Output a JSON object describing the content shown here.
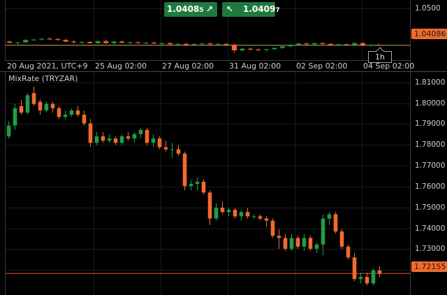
{
  "top_panel": {
    "bid_price": "1.0408",
    "bid_price_fraction": "5",
    "ask_price": "1.0409",
    "ask_price_fraction": "7",
    "current_price_tag": "1.04086",
    "timeframe": "1h",
    "y_ticks": [
      "1.0500"
    ],
    "dates": [
      "20 Aug 2021, UTC+9",
      "25 Aug 02:00",
      "27 Aug 02:00",
      "31 Aug 02:00",
      "02 Sep 02:00",
      "04 Sep 02:00"
    ]
  },
  "indicator_panel": {
    "name": "MixRate (TRYZAR)",
    "current_value_tag": "1.72155",
    "y_ticks": [
      "1.81000",
      "1.80000",
      "1.79000",
      "1.78000",
      "1.77000",
      "1.76000",
      "1.75000",
      "1.74000",
      "1.73000",
      "1.72000"
    ]
  },
  "colors": {
    "bull": "#1f9d48",
    "bear": "#f26a2e",
    "price_line_top": "#c9a94a",
    "price_line_bottom": "#e8543a",
    "tag_top": "#f26a2e",
    "tag_bottom": "#f26a2e",
    "button_green": "#1e7a3c"
  },
  "chart_data": [
    {
      "type": "candlestick",
      "title": "",
      "ylim": [
        1.0375,
        1.0515
      ],
      "last_value": 1.04086,
      "candles": [
        [
          1.0418,
          1.042,
          1.0413,
          1.0415
        ],
        [
          1.0415,
          1.0418,
          1.0411,
          1.0416
        ],
        [
          1.0416,
          1.0424,
          1.0414,
          1.0422
        ],
        [
          1.0422,
          1.0425,
          1.0419,
          1.0423
        ],
        [
          1.0423,
          1.0426,
          1.042,
          1.0425
        ],
        [
          1.0425,
          1.0428,
          1.0421,
          1.0424
        ],
        [
          1.0424,
          1.0427,
          1.042,
          1.0422
        ],
        [
          1.0422,
          1.0425,
          1.0416,
          1.0418
        ],
        [
          1.0418,
          1.0421,
          1.0413,
          1.0416
        ],
        [
          1.0416,
          1.0419,
          1.0412,
          1.0417
        ],
        [
          1.0417,
          1.0419,
          1.0413,
          1.0414
        ],
        [
          1.0414,
          1.0421,
          1.0412,
          1.0419
        ],
        [
          1.0419,
          1.0423,
          1.0412,
          1.0414
        ],
        [
          1.0414,
          1.042,
          1.041,
          1.0418
        ],
        [
          1.0418,
          1.042,
          1.0413,
          1.0415
        ],
        [
          1.0415,
          1.0418,
          1.0412,
          1.0416
        ],
        [
          1.0416,
          1.0418,
          1.0413,
          1.0414
        ],
        [
          1.0414,
          1.0417,
          1.0411,
          1.0415
        ],
        [
          1.0415,
          1.0418,
          1.0412,
          1.0413
        ],
        [
          1.0413,
          1.0416,
          1.041,
          1.0414
        ],
        [
          1.0414,
          1.0416,
          1.041,
          1.0411
        ],
        [
          1.0411,
          1.0414,
          1.0408,
          1.0412
        ],
        [
          1.0412,
          1.0415,
          1.0409,
          1.041
        ],
        [
          1.041,
          1.0413,
          1.0407,
          1.0412
        ],
        [
          1.0412,
          1.0415,
          1.041,
          1.0413
        ],
        [
          1.0413,
          1.0416,
          1.041,
          1.0411
        ],
        [
          1.0411,
          1.0414,
          1.0408,
          1.0412
        ],
        [
          1.0412,
          1.0414,
          1.0409,
          1.041
        ],
        [
          1.041,
          1.0413,
          1.039,
          1.0396
        ],
        [
          1.0396,
          1.0402,
          1.0393,
          1.04
        ],
        [
          1.04,
          1.0403,
          1.0396,
          1.0398
        ],
        [
          1.0398,
          1.0401,
          1.0394,
          1.0397
        ],
        [
          1.0397,
          1.04,
          1.0393,
          1.0399
        ],
        [
          1.0399,
          1.0403,
          1.0396,
          1.0402
        ],
        [
          1.0402,
          1.0407,
          1.04,
          1.0406
        ],
        [
          1.0406,
          1.0412,
          1.0404,
          1.041
        ],
        [
          1.041,
          1.0415,
          1.0408,
          1.0413
        ],
        [
          1.0413,
          1.0416,
          1.041,
          1.0411
        ],
        [
          1.0411,
          1.0415,
          1.0409,
          1.0414
        ],
        [
          1.0414,
          1.0416,
          1.041,
          1.0412
        ],
        [
          1.0412,
          1.0414,
          1.0408,
          1.0409
        ],
        [
          1.0409,
          1.0412,
          1.0406,
          1.0411
        ],
        [
          1.0411,
          1.0413,
          1.0408,
          1.041
        ],
        [
          1.041,
          1.0416,
          1.0408,
          1.0414
        ],
        [
          1.0414,
          1.0416,
          1.0406,
          1.0408
        ],
        [
          1.0408,
          1.0411,
          1.0405,
          1.041
        ],
        [
          1.041,
          1.0412,
          1.0407,
          1.0409
        ]
      ]
    },
    {
      "type": "candlestick",
      "title": "MixRate (TRYZAR)",
      "ylim": [
        1.7155,
        1.8125
      ],
      "last_value": 1.72155,
      "candles": [
        [
          1.785,
          1.792,
          1.784,
          1.79
        ],
        [
          1.79,
          1.8,
          1.788,
          1.798
        ],
        [
          1.799,
          1.802,
          1.795,
          1.796
        ],
        [
          1.796,
          1.805,
          1.795,
          1.804
        ],
        [
          1.805,
          1.808,
          1.799,
          1.8
        ],
        [
          1.801,
          1.802,
          1.795,
          1.797
        ],
        [
          1.797,
          1.801,
          1.796,
          1.8
        ],
        [
          1.8,
          1.801,
          1.796,
          1.798
        ],
        [
          1.798,
          1.799,
          1.793,
          1.794
        ],
        [
          1.794,
          1.797,
          1.793,
          1.795
        ],
        [
          1.795,
          1.798,
          1.794,
          1.797
        ],
        [
          1.797,
          1.799,
          1.794,
          1.795
        ],
        [
          1.795,
          1.797,
          1.79,
          1.791
        ],
        [
          1.791,
          1.793,
          1.78,
          1.782
        ],
        [
          1.782,
          1.787,
          1.781,
          1.785
        ],
        [
          1.785,
          1.787,
          1.782,
          1.783
        ],
        [
          1.783,
          1.786,
          1.782,
          1.784
        ],
        [
          1.784,
          1.785,
          1.781,
          1.782
        ],
        [
          1.782,
          1.786,
          1.781,
          1.785
        ],
        [
          1.785,
          1.787,
          1.783,
          1.784
        ],
        [
          1.784,
          1.787,
          1.782,
          1.786
        ],
        [
          1.786,
          1.789,
          1.784,
          1.788
        ],
        [
          1.788,
          1.789,
          1.781,
          1.782
        ],
        [
          1.782,
          1.786,
          1.78,
          1.784
        ],
        [
          1.784,
          1.785,
          1.779,
          1.78
        ],
        [
          1.78,
          1.783,
          1.778,
          1.779
        ],
        [
          1.779,
          1.782,
          1.775,
          1.779
        ],
        [
          1.779,
          1.781,
          1.776,
          1.777
        ],
        [
          1.777,
          1.778,
          1.76,
          1.762
        ],
        [
          1.762,
          1.765,
          1.76,
          1.763
        ],
        [
          1.763,
          1.766,
          1.76,
          1.764
        ],
        [
          1.764,
          1.765,
          1.758,
          1.759
        ],
        [
          1.759,
          1.76,
          1.744,
          1.747
        ],
        [
          1.747,
          1.754,
          1.746,
          1.752
        ],
        [
          1.752,
          1.755,
          1.749,
          1.75
        ],
        [
          1.75,
          1.752,
          1.748,
          1.751
        ],
        [
          1.751,
          1.752,
          1.747,
          1.748
        ],
        [
          1.748,
          1.751,
          1.746,
          1.75
        ],
        [
          1.75,
          1.752,
          1.747,
          1.748
        ],
        [
          1.748,
          1.749,
          1.747,
          1.748
        ],
        [
          1.748,
          1.749,
          1.746,
          1.747
        ],
        [
          1.747,
          1.748,
          1.743,
          1.746
        ],
        [
          1.746,
          1.747,
          1.738,
          1.739
        ],
        [
          1.739,
          1.742,
          1.733,
          1.738
        ],
        [
          1.738,
          1.74,
          1.732,
          1.733
        ],
        [
          1.733,
          1.74,
          1.732,
          1.738
        ],
        [
          1.738,
          1.739,
          1.733,
          1.734
        ],
        [
          1.734,
          1.74,
          1.732,
          1.738
        ],
        [
          1.738,
          1.739,
          1.732,
          1.733
        ],
        [
          1.733,
          1.736,
          1.731,
          1.735
        ],
        [
          1.735,
          1.749,
          1.73,
          1.747
        ],
        [
          1.747,
          1.75,
          1.744,
          1.749
        ],
        [
          1.749,
          1.75,
          1.74,
          1.741
        ],
        [
          1.741,
          1.742,
          1.733,
          1.734
        ],
        [
          1.734,
          1.735,
          1.728,
          1.729
        ],
        [
          1.729,
          1.731,
          1.718,
          1.719
        ],
        [
          1.719,
          1.722,
          1.717,
          1.72
        ],
        [
          1.72,
          1.722,
          1.716,
          1.717
        ],
        [
          1.717,
          1.724,
          1.716,
          1.723
        ],
        [
          1.723,
          1.725,
          1.72,
          1.7215
        ]
      ]
    }
  ]
}
